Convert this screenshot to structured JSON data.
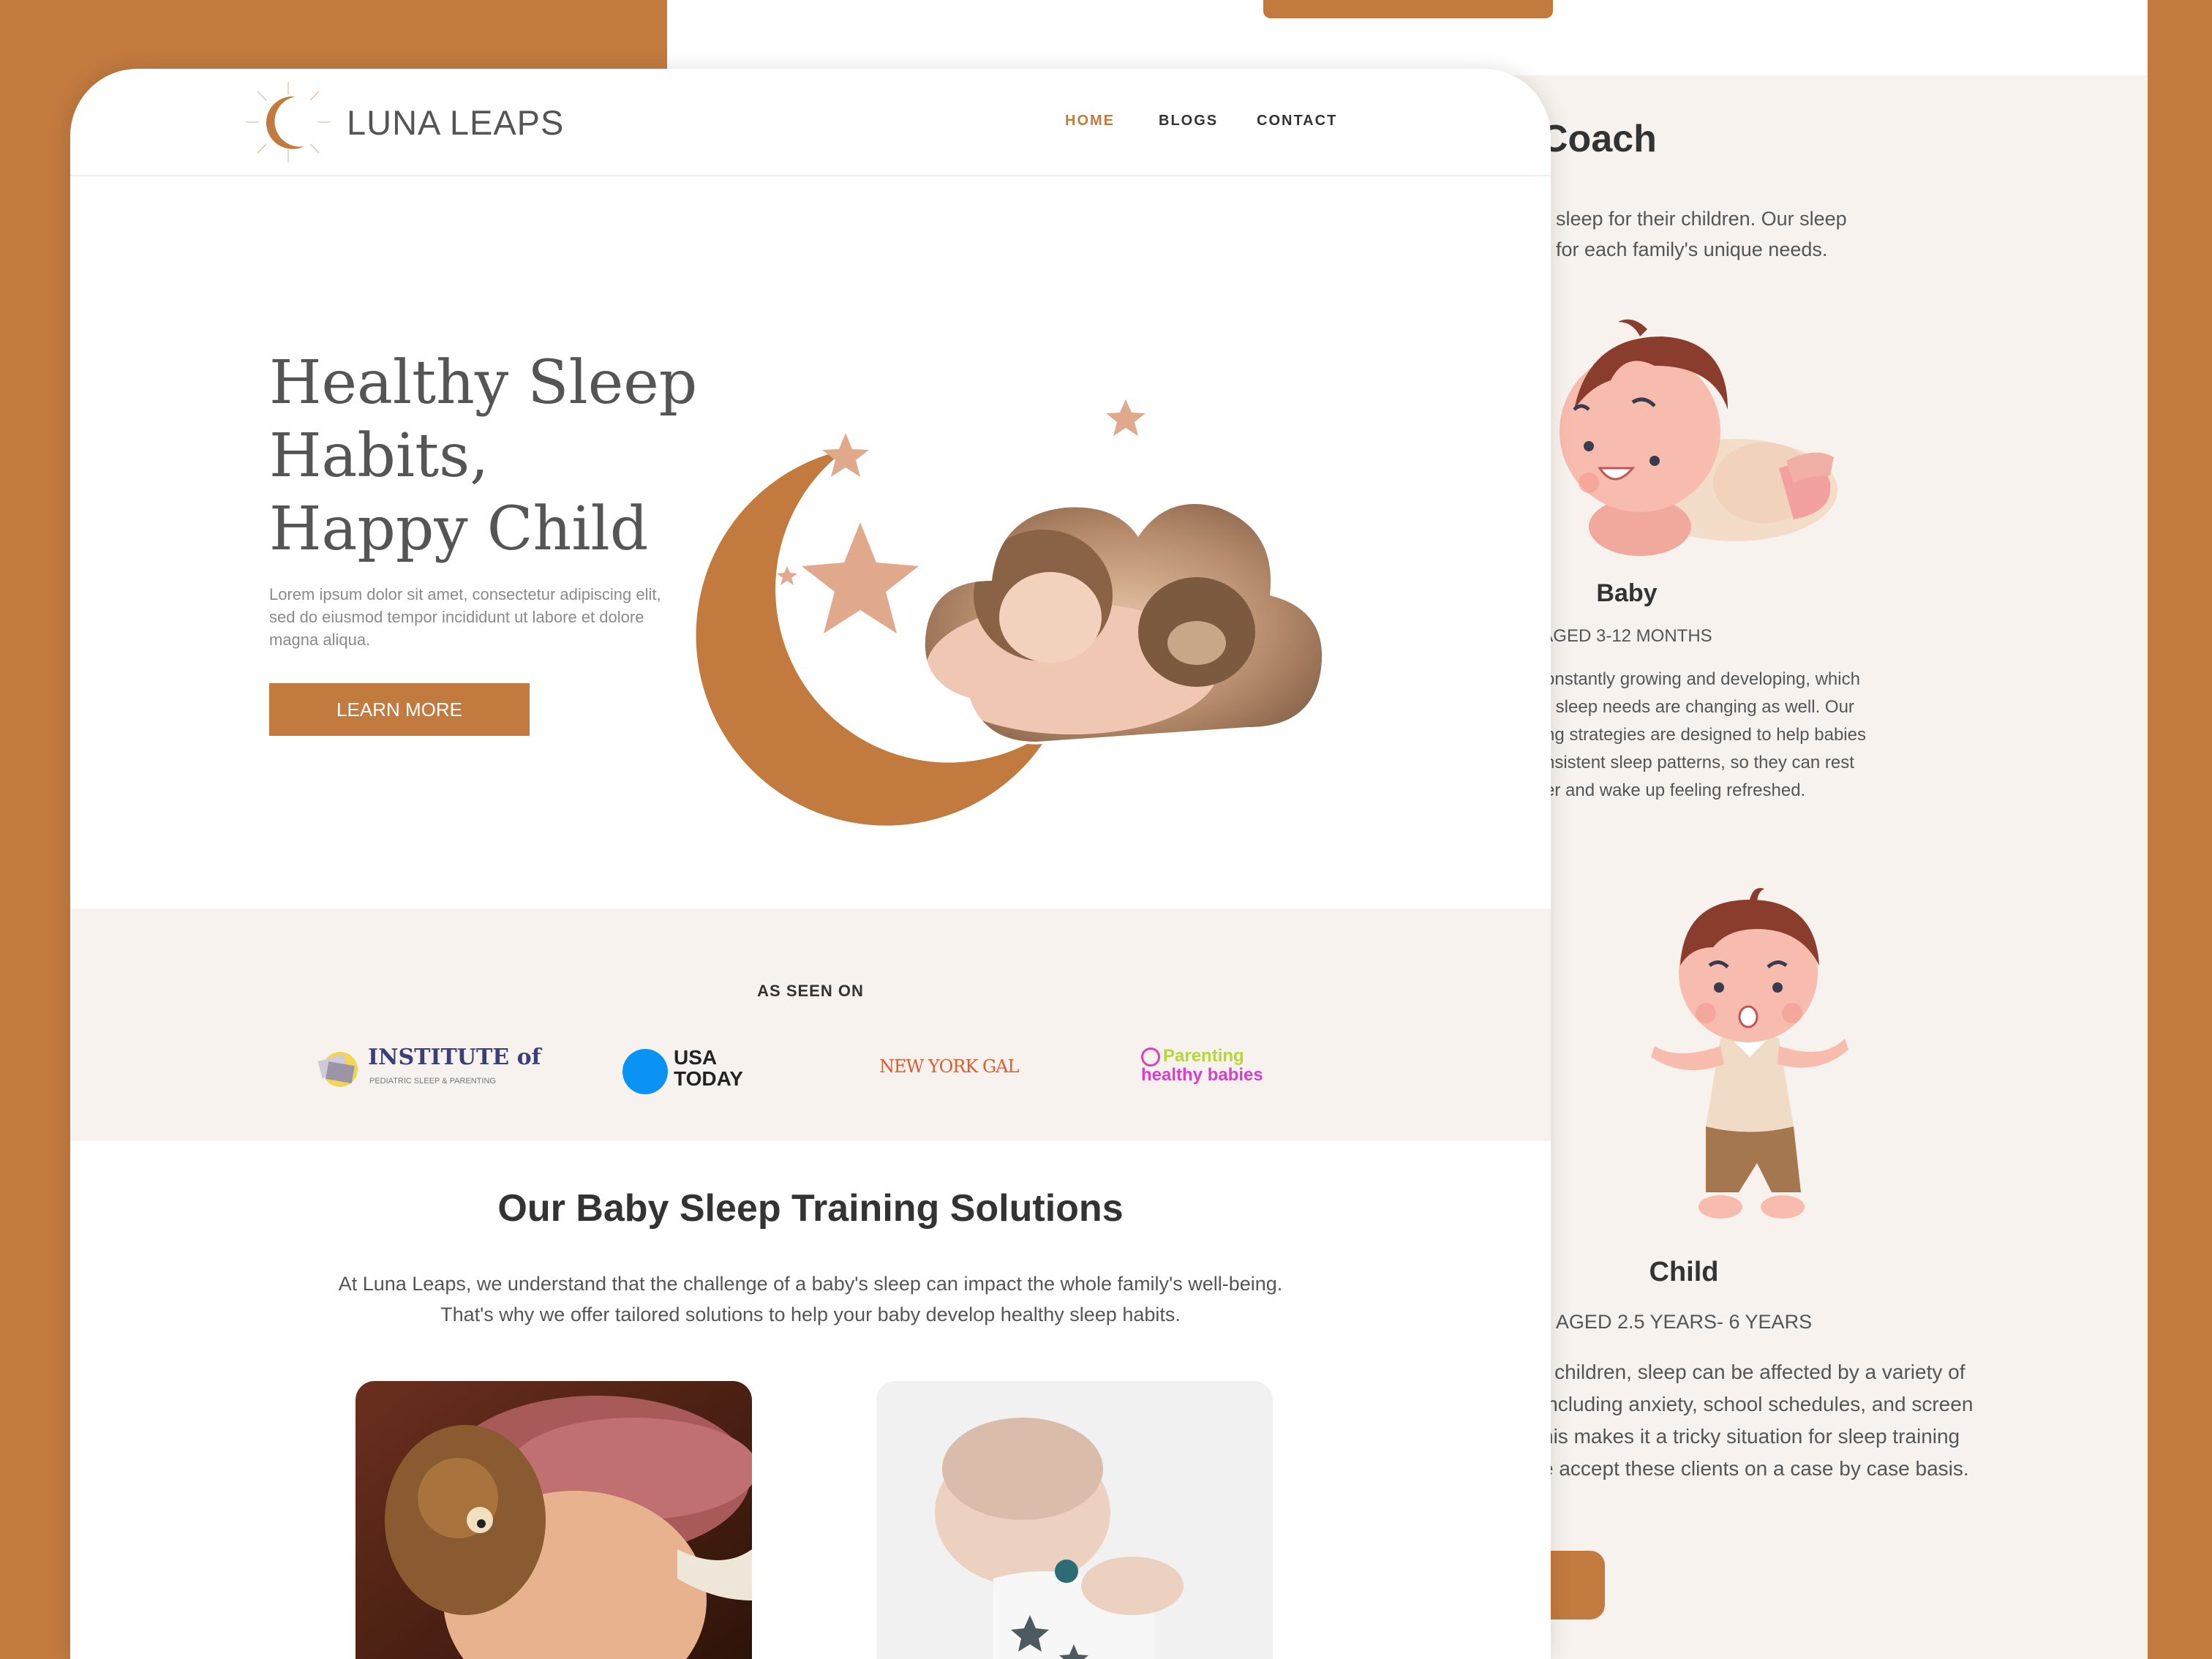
{
  "colors": {
    "accent": "#c27a3f",
    "cream": "#f7f2ee",
    "text_dark": "#333333",
    "text_mid": "#555555"
  },
  "back_page": {
    "title": "Coach",
    "intro_lines": [
      "sleep for their children. Our sleep",
      "for each family's unique needs."
    ],
    "baby_card": {
      "title": "Baby",
      "age": "AGED 3-12 MONTHS",
      "lines": [
        "onstantly growing and developing, which",
        "r sleep needs are changing as well. Our",
        "ng strategies are designed to help babies",
        "nsistent sleep patterns, so they can rest",
        "er and wake up feeling refreshed."
      ]
    },
    "child_card": {
      "title": "Child",
      "age": "AGED 2.5 YEARS- 6 YEARS",
      "lines": [
        "r children, sleep can be affected by a variety of",
        "including anxiety, school schedules, and screen",
        "his makes it a tricky situation for sleep training",
        "e accept these clients on a case by case basis."
      ]
    }
  },
  "nav": {
    "brand": "LUNA LEAPS",
    "items": [
      {
        "label": "HOME",
        "active": true
      },
      {
        "label": "BLOGS",
        "active": false
      },
      {
        "label": "CONTACT",
        "active": false
      }
    ]
  },
  "hero": {
    "title_lines": [
      "Healthy Sleep",
      "Habits,",
      "Happy Child"
    ],
    "text": "Lorem ipsum dolor sit amet, consectetur adipiscing elit, sed do eiusmod tempor incididunt ut labore et dolore magna aliqua.",
    "button": "LEARN MORE"
  },
  "seen_on": {
    "label": "AS SEEN ON",
    "logos": {
      "institute_main": "INSTITUTE of",
      "institute_sub": "PEDIATRIC SLEEP & PARENTING",
      "usa_line1": "USA",
      "usa_line2": "TODAY",
      "nyg": "NEW YORK GAL",
      "parenting_line1": "Parenting",
      "parenting_line2": "healthy babies"
    }
  },
  "solutions": {
    "title": "Our Baby Sleep Training Solutions",
    "text": "At Luna Leaps, we understand that the challenge of a baby's sleep can impact the whole family's well-being. That's why we offer tailored solutions to help your baby develop healthy sleep habits."
  },
  "icons": [
    "moon-logo-icon",
    "star-icon",
    "moon-icon",
    "cloud-photo",
    "baby-illustration",
    "child-illustration"
  ]
}
